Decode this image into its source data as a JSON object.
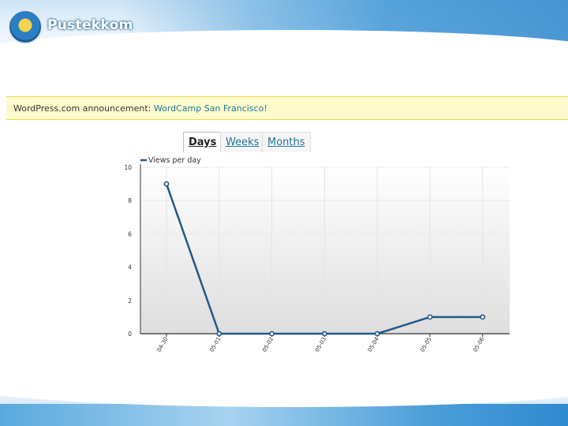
{
  "header": {
    "brand": "Pustekkom",
    "logo_icon": "institution-emblem-icon"
  },
  "announcement": {
    "prefix": "WordPress.com announcement: ",
    "link": "WordCamp San Francisco!"
  },
  "tabs": [
    {
      "label": "Days",
      "active": true
    },
    {
      "label": "Weeks",
      "active": false
    },
    {
      "label": "Months",
      "active": false
    }
  ],
  "chart_data": {
    "type": "line",
    "title": "",
    "xlabel": "",
    "ylabel": "",
    "legend": "top-left",
    "grid": true,
    "ylim": [
      0,
      10
    ],
    "y_ticks": [
      0,
      2,
      4,
      6,
      8,
      10
    ],
    "categories": [
      "04-30",
      "05-01",
      "05-02",
      "05-03",
      "05-04",
      "05-05",
      "05-06"
    ],
    "series": [
      {
        "name": "Views per day",
        "color": "#21598a",
        "values": [
          9,
          0,
          0,
          0,
          0,
          1,
          1
        ]
      }
    ]
  }
}
